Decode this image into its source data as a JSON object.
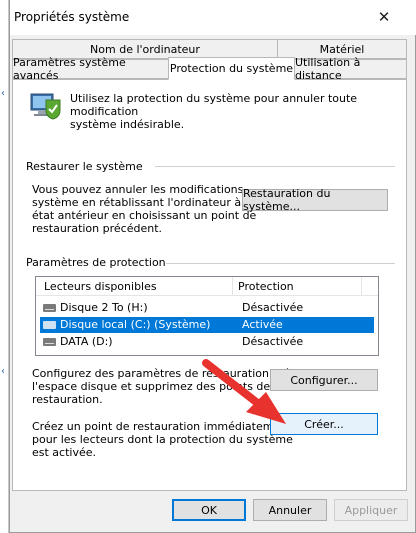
{
  "window": {
    "title": "Propriétés système",
    "close_glyph": "✕"
  },
  "tabs": {
    "row1": [
      {
        "label": "Nom de l'ordinateur"
      },
      {
        "label": "Matériel"
      }
    ],
    "row2": [
      {
        "label": "Paramètres système avancés"
      },
      {
        "label": "Protection du système",
        "active": true
      },
      {
        "label": "Utilisation à distance"
      }
    ]
  },
  "intro": {
    "text_line1": "Utilisez la protection du système pour annuler toute modification",
    "text_line2": "système indésirable."
  },
  "restore": {
    "title": "Restaurer le système",
    "desc_line1": "Vous pouvez annuler les modifications",
    "desc_line2": "système en rétablissant l'ordinateur à un",
    "desc_line3": "état antérieur en choisissant un point de",
    "desc_line4": "restauration précédent.",
    "button": "Restauration du système..."
  },
  "protection": {
    "title": "Paramètres de protection",
    "columns": {
      "drives": "Lecteurs disponibles",
      "protection": "Protection"
    },
    "rows": [
      {
        "name": "Disque 2 To (H:)",
        "status": "Désactivée"
      },
      {
        "name": "Disque local (C:) (Système)",
        "status": "Activée"
      },
      {
        "name": "DATA (D:)",
        "status": "Désactivée"
      }
    ],
    "configure_line1": "Configurez des paramètres de restauration, gérez",
    "configure_line2": "l'espace disque et supprimez des points de",
    "configure_line3": "restauration.",
    "configure_button": "Configurer...",
    "create_line1": "Créez un point de restauration immédiatement",
    "create_line2": "pour les lecteurs dont la protection du système",
    "create_line3": "est activée.",
    "create_button": "Créer..."
  },
  "footer": {
    "ok": "OK",
    "cancel": "Annuler",
    "apply": "Appliquer"
  },
  "colors": {
    "accent": "#0078d7",
    "arrow": "#e8322e"
  }
}
